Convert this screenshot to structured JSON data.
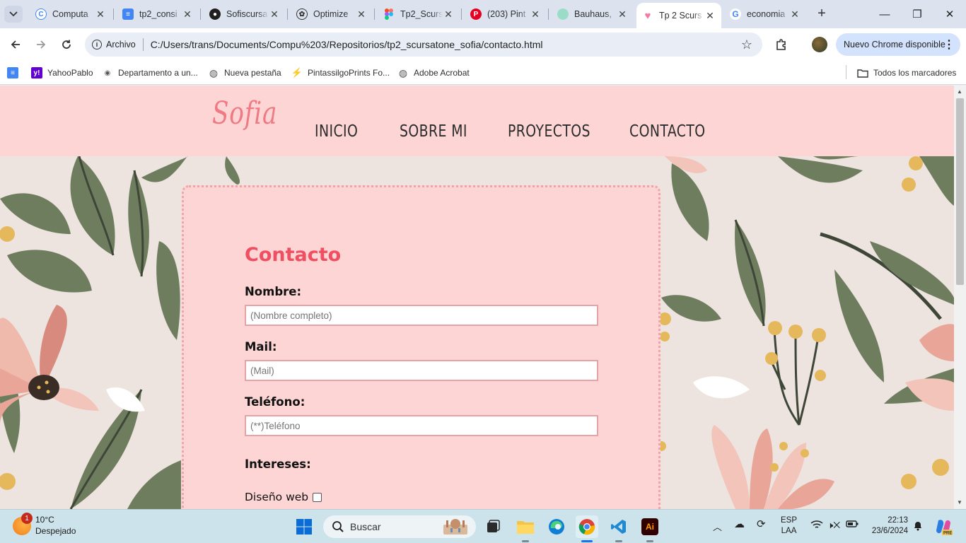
{
  "browser": {
    "tabs": [
      {
        "title": "Computa",
        "icon": "educational-site-icon"
      },
      {
        "title": "tp2_consi",
        "icon": "google-docs-icon"
      },
      {
        "title": "Sofiscursa",
        "icon": "github-icon"
      },
      {
        "title": "Optimize",
        "icon": "optimize-icon"
      },
      {
        "title": "Tp2_Scurs",
        "icon": "figma-icon"
      },
      {
        "title": "(203) Pint",
        "icon": "pinterest-icon"
      },
      {
        "title": "Bauhaus,",
        "icon": "generic-site-icon"
      },
      {
        "title": "Tp 2 Scurs",
        "icon": "heart-favicon-icon"
      },
      {
        "title": "economia",
        "icon": "google-icon"
      }
    ],
    "address": {
      "chip": "Archivo",
      "url": "C:/Users/trans/Documents/Compu%203/Repositorios/tp2_scursatone_sofia/contacto.html"
    },
    "update_button": "Nuevo Chrome disponible",
    "bookmarks": [
      {
        "label": "",
        "icon": "docs-icon"
      },
      {
        "label": "YahooPablo",
        "icon": "yahoo-icon"
      },
      {
        "label": "Departamento a un...",
        "icon": "eye-icon"
      },
      {
        "label": "Nueva pestaña",
        "icon": "globe-icon"
      },
      {
        "label": "PintassilgoPrints Fo...",
        "icon": "bolt-icon"
      },
      {
        "label": "Adobe Acrobat",
        "icon": "globe-icon"
      }
    ],
    "all_bookmarks": "Todos los marcadores"
  },
  "site": {
    "logo": "Sofia",
    "nav": [
      "INICIO",
      "SOBRE MI",
      "PROYECTOS",
      "CONTACTO"
    ],
    "form": {
      "title": "Contacto",
      "fields": [
        {
          "label": "Nombre:",
          "placeholder": "(Nombre completo)"
        },
        {
          "label": "Mail:",
          "placeholder": "(Mail)"
        },
        {
          "label": "Teléfono:",
          "placeholder": "(**)Teléfono"
        }
      ],
      "interests_label": "Intereses:",
      "interest_option": "Diseño web"
    },
    "colors": {
      "header_bg": "#fdd5d5",
      "logo": "#f07a83",
      "title": "#f04f62",
      "card_border": "#f2a3a8",
      "leaf": "#6f7d5f",
      "petal": "#e8a598"
    }
  },
  "taskbar": {
    "weather_temp": "10°C",
    "weather_desc": "Despejado",
    "weather_badge": "1",
    "search_placeholder": "Buscar",
    "lang_top": "ESP",
    "lang_bottom": "LAA",
    "time": "22:13",
    "date": "23/6/2024"
  }
}
